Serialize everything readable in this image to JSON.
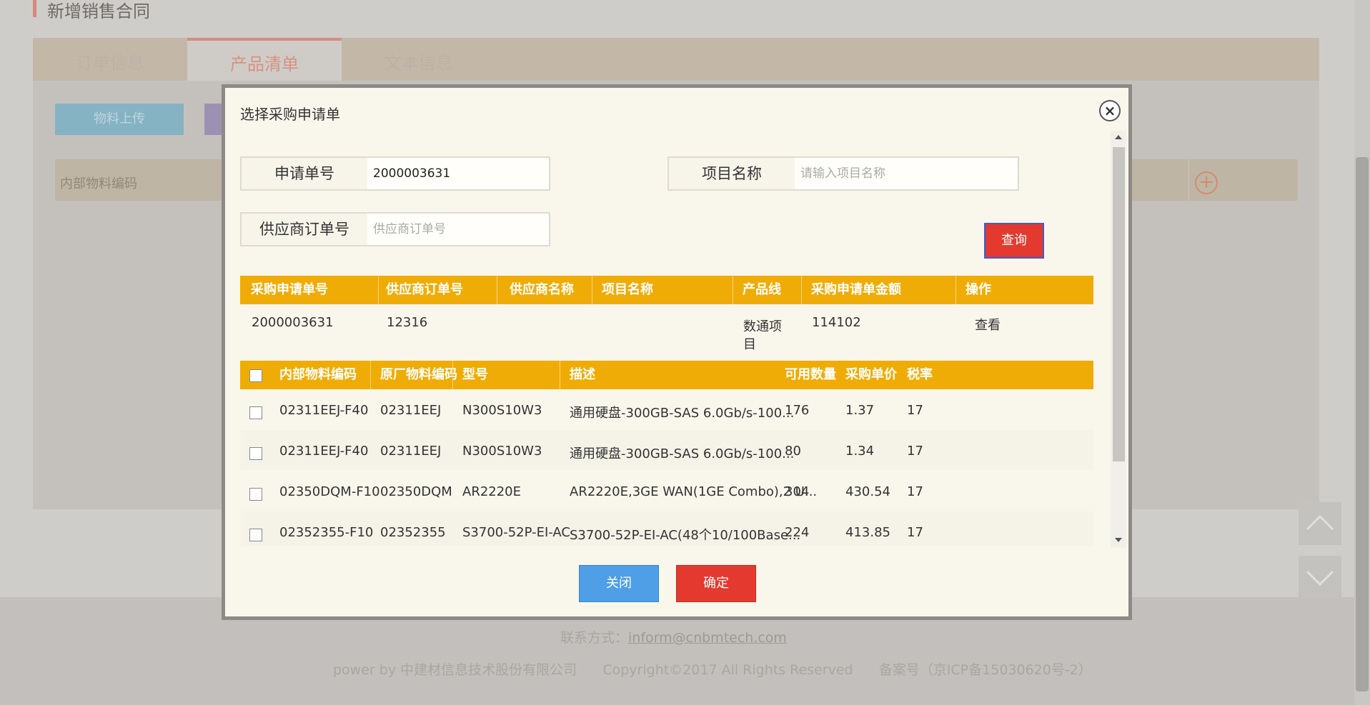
{
  "page": {
    "title": "新增销售合同",
    "tabs": [
      "订单信息",
      "产品清单",
      "文本信息"
    ],
    "upload_button": "物料上传",
    "bg_table_header": "内部物料编码",
    "footer_contact_label": "联系方式：",
    "footer_contact_email": "inform@cnbmtech.com",
    "footer_copyright": "power by 中建材信息技术股份有限公司      Copyright©2017 All Rights Reserved      备案号（京ICP备15030620号-2）"
  },
  "dialog": {
    "title": "选择采购申请单",
    "fields": {
      "request_no_label": "申请单号",
      "request_no_value": "2000003631",
      "project_name_label": "项目名称",
      "project_name_placeholder": "请输入项目名称",
      "supplier_order_label": "供应商订单号",
      "supplier_order_placeholder": "供应商订单号"
    },
    "query_button": "查询",
    "request_table": {
      "headers": [
        "采购申请单号",
        "供应商订单号",
        "供应商名称",
        "项目名称",
        "产品线",
        "采购申请单金额",
        "操作"
      ],
      "rows": [
        {
          "request_no": "2000003631",
          "supplier_order": "12316",
          "supplier_name": "",
          "project_name": "",
          "product_line_1": "数通项",
          "product_line_2": "目",
          "amount": "114102",
          "action": "查看"
        }
      ]
    },
    "material_table": {
      "headers": [
        "内部物料编码",
        "原厂物料编码",
        "型号",
        "描述",
        "可用数量",
        "采购单价",
        "税率"
      ],
      "rows": [
        {
          "internal": "02311EEJ-F40",
          "original": "02311EEJ",
          "model": "N300S10W3",
          "desc": "通用硬盘-300GB-SAS 6.0Gb/s-100...",
          "qty": "176",
          "price": "1.37",
          "tax": "17"
        },
        {
          "internal": "02311EEJ-F40",
          "original": "02311EEJ",
          "model": "N300S10W3",
          "desc": "通用硬盘-300GB-SAS 6.0Gb/s-100...",
          "qty": "80",
          "price": "1.34",
          "tax": "17"
        },
        {
          "internal": "02350DQM-F10",
          "original": "02350DQM",
          "model": "AR2220E",
          "desc": "AR2220E,3GE WAN(1GE Combo),2 U...",
          "qty": "304",
          "price": "430.54",
          "tax": "17"
        },
        {
          "internal": "02352355-F10",
          "original": "02352355",
          "model": "S3700-52P-EI-AC",
          "desc": "S3700-52P-EI-AC(48个10/100Base...",
          "qty": "224",
          "price": "413.85",
          "tax": "17"
        }
      ]
    },
    "close_button": "关闭",
    "confirm_button": "确定"
  }
}
